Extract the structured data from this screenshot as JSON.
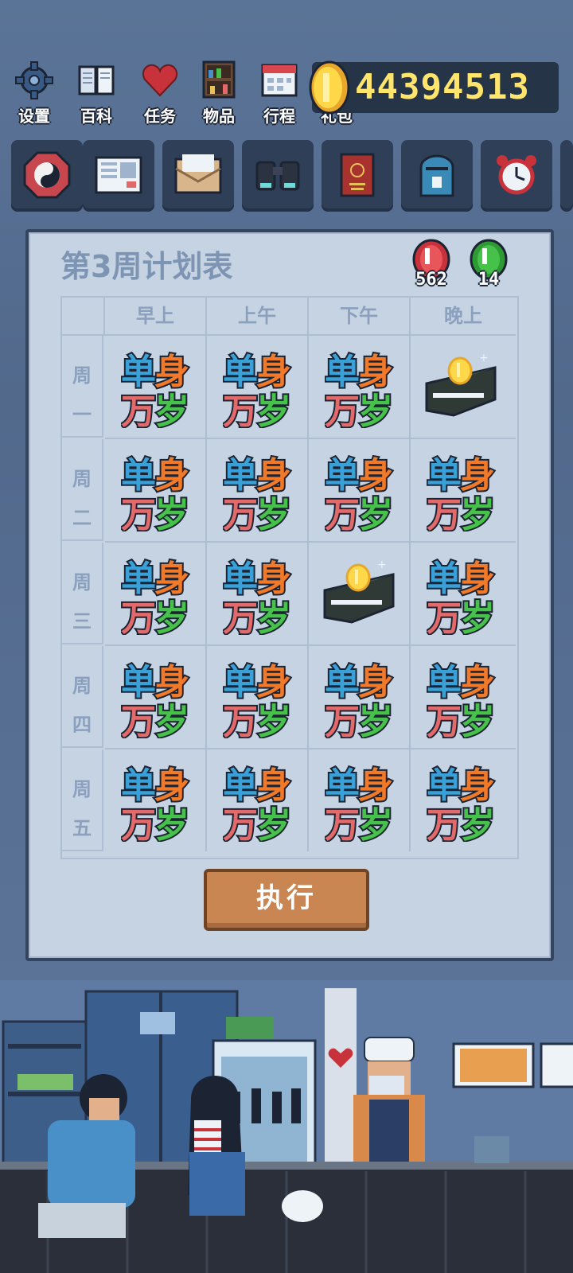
{
  "top_nav": {
    "items": [
      {
        "label": "设置",
        "icon": "gear-icon"
      },
      {
        "label": "百科",
        "icon": "book-icon"
      },
      {
        "label": "任务",
        "icon": "heart-icon"
      },
      {
        "label": "物品",
        "icon": "shelf-icon"
      },
      {
        "label": "行程",
        "icon": "calendar-icon"
      },
      {
        "label": "礼包",
        "icon": "gift-icon"
      }
    ],
    "coins": "44394513"
  },
  "tools": [
    "yin-yang-icon",
    "newspaper-icon",
    "envelope-icon",
    "binoculars-icon",
    "passport-icon",
    "mailbox-icon",
    "alarm-clock-icon"
  ],
  "plan": {
    "title": "第3周计划表",
    "red_gem": "562",
    "green_gem": "14",
    "columns": [
      "早上",
      "上午",
      "下午",
      "晚上"
    ],
    "rows": [
      {
        "day": [
          "周",
          "一"
        ],
        "slots": [
          "single-logo",
          "single-logo",
          "single-logo",
          "money-wallet"
        ]
      },
      {
        "day": [
          "周",
          "二"
        ],
        "slots": [
          "single-logo",
          "single-logo",
          "single-logo",
          "single-logo"
        ]
      },
      {
        "day": [
          "周",
          "三"
        ],
        "slots": [
          "single-logo",
          "single-logo",
          "money-wallet",
          "single-logo"
        ]
      },
      {
        "day": [
          "周",
          "四"
        ],
        "slots": [
          "single-logo",
          "single-logo",
          "single-logo",
          "single-logo"
        ]
      },
      {
        "day": [
          "周",
          "五"
        ],
        "slots": [
          "single-logo",
          "single-logo",
          "single-logo",
          "single-logo"
        ]
      }
    ],
    "execute_label": "执行",
    "logo_text": [
      "单",
      "身",
      "万",
      "岁"
    ]
  },
  "colors": {
    "logo_blue": "#3aa0d8",
    "logo_orange": "#f07a2a",
    "logo_red": "#e36a6a",
    "logo_green": "#46c24a",
    "coin_yellow": "#ffe56b",
    "button_orange": "#c98652"
  }
}
